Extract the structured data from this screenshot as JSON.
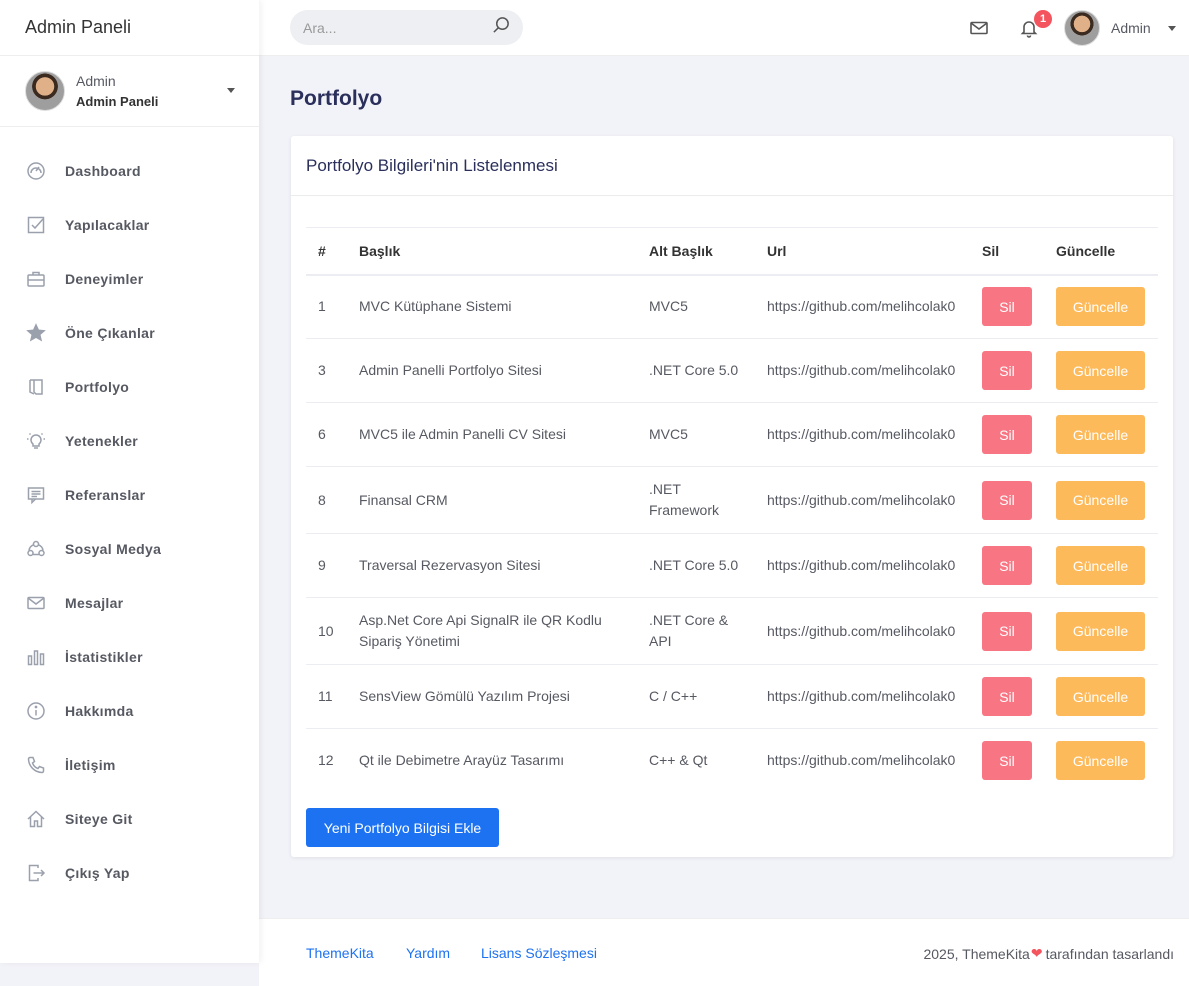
{
  "brand": "Admin Paneli",
  "user": {
    "name": "Admin",
    "role": "Admin Paneli"
  },
  "sidebar": {
    "items": [
      {
        "label": "Dashboard",
        "icon": "dashboard-icon"
      },
      {
        "label": "Yapılacaklar",
        "icon": "checkbox-icon"
      },
      {
        "label": "Deneyimler",
        "icon": "briefcase-icon"
      },
      {
        "label": "Öne Çıkanlar",
        "icon": "star-icon"
      },
      {
        "label": "Portfolyo",
        "icon": "book-icon"
      },
      {
        "label": "Yetenekler",
        "icon": "bulb-icon"
      },
      {
        "label": "Referanslar",
        "icon": "comment-icon"
      },
      {
        "label": "Sosyal Medya",
        "icon": "share-icon"
      },
      {
        "label": "Mesajlar",
        "icon": "envelope-icon"
      },
      {
        "label": "İstatistikler",
        "icon": "chart-icon"
      },
      {
        "label": "Hakkımda",
        "icon": "info-icon"
      },
      {
        "label": "İletişim",
        "icon": "phone-icon"
      },
      {
        "label": "Siteye Git",
        "icon": "home-icon"
      },
      {
        "label": "Çıkış Yap",
        "icon": "logout-icon"
      }
    ]
  },
  "header": {
    "search_placeholder": "Ara...",
    "notification_count": "1",
    "user_name": "Admin"
  },
  "main": {
    "page_title": "Portfolyo",
    "card_title": "Portfolyo Bilgileri'nin Listelenmesi",
    "table": {
      "columns": [
        "#",
        "Başlık",
        "Alt Başlık",
        "Url",
        "Sil",
        "Güncelle"
      ],
      "delete_label": "Sil",
      "update_label": "Güncelle",
      "rows": [
        {
          "id": "1",
          "title": "MVC Kütüphane Sistemi",
          "subtitle": "MVC5",
          "url": "https://github.com/melihcolak0"
        },
        {
          "id": "3",
          "title": "Admin Panelli Portfolyo Sitesi",
          "subtitle": ".NET Core 5.0",
          "url": "https://github.com/melihcolak0"
        },
        {
          "id": "6",
          "title": "MVC5 ile Admin Panelli CV Sitesi",
          "subtitle": "MVC5",
          "url": "https://github.com/melihcolak0"
        },
        {
          "id": "8",
          "title": "Finansal CRM",
          "subtitle": ".NET Framework",
          "url": "https://github.com/melihcolak0"
        },
        {
          "id": "9",
          "title": "Traversal Rezervasyon Sitesi",
          "subtitle": ".NET Core 5.0",
          "url": "https://github.com/melihcolak0"
        },
        {
          "id": "10",
          "title": "Asp.Net Core Api SignalR ile QR Kodlu Sipariş Yönetimi",
          "subtitle": ".NET Core & API",
          "url": "https://github.com/melihcolak0"
        },
        {
          "id": "11",
          "title": "SensView Gömülü Yazılım Projesi",
          "subtitle": "C / C++",
          "url": "https://github.com/melihcolak0"
        },
        {
          "id": "12",
          "title": "Qt ile Debimetre Arayüz Tasarımı",
          "subtitle": "C++ & Qt",
          "url": "https://github.com/melihcolak0"
        }
      ]
    },
    "add_button": "Yeni Portfolyo Bilgisi Ekle"
  },
  "footer": {
    "links": [
      "ThemeKita",
      "Yardım",
      "Lisans Sözleşmesi"
    ],
    "copyright_prefix": "2025, ThemeKita",
    "copyright_suffix": "tarafından tasarlandı"
  },
  "colors": {
    "primary": "#1d72f2",
    "danger": "#f87683",
    "warning": "#fdba5b",
    "badge": "#f3545d"
  }
}
